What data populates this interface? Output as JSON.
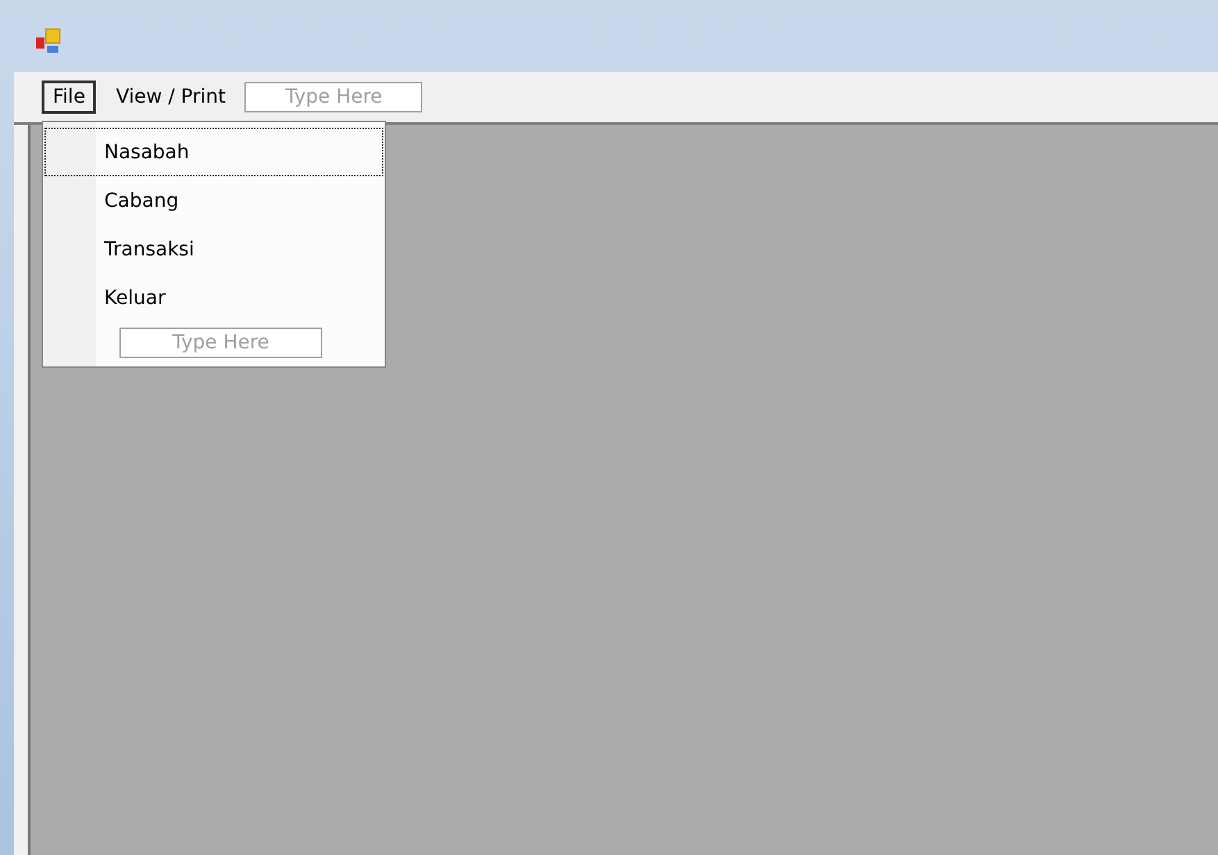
{
  "menu_bar": {
    "items": [
      {
        "label": "File",
        "selected": true
      },
      {
        "label": "View / Print",
        "selected": false
      }
    ],
    "new_item_placeholder": "Type Here"
  },
  "file_menu": {
    "items": [
      {
        "label": "Nasabah",
        "selected": true
      },
      {
        "label": "Cabang",
        "selected": false
      },
      {
        "label": "Transaksi",
        "selected": false
      },
      {
        "label": "Keluar",
        "selected": false
      }
    ],
    "new_item_placeholder": "Type Here"
  }
}
